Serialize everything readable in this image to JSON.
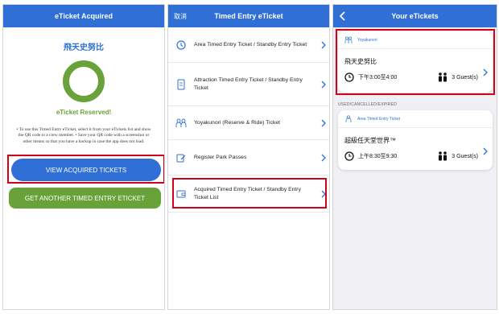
{
  "panel1": {
    "title": "eTicket Acquired",
    "ride_name": "飛天史努比",
    "status": "eTicket Reserved!",
    "note": "• To use this Timed Entry eTicket, select it from your eTickets list and show the QR code to a crew member. • Save your QR code with a screenshot or other means so that you have a backup in case the app does not load.",
    "btn_view": "VIEW ACQUIRED TICKETS",
    "btn_get": "GET ANOTHER TIMED ENTRY ETICKET",
    "colors": {
      "blue": "#2f6fd6",
      "green": "#6aa23a",
      "highlight": "#d0021b"
    }
  },
  "panel2": {
    "cancel": "取消",
    "title": "Timed Entry eTicket",
    "items": [
      {
        "label": "Area Timed Entry Ticket / Standby Entry Ticket",
        "icon": "clock-icon"
      },
      {
        "label": "Attraction Timed Entry Ticket / Standby Entry Ticket",
        "icon": "ticket-icon"
      },
      {
        "label": "Yoyakunori (Reserve & Ride) Ticket",
        "icon": "people-icon"
      },
      {
        "label": "Register Park Passes",
        "icon": "pass-icon"
      },
      {
        "label": "Acquired Timed Entry Ticket / Standby Entry Ticket List",
        "icon": "wallet-icon"
      }
    ]
  },
  "panel3": {
    "title": "Your eTickets",
    "section_label": "USED/CANCELLED/EXPIRED",
    "cards": [
      {
        "type": "Yoyakunori",
        "name": "飛天史努比",
        "time": "下午3:00至4:00",
        "guests": "3 Guest(s)"
      },
      {
        "type": "Area Timed Entry Ticket",
        "name": "超級任天堂世界™",
        "time": "上午8:30至9:30",
        "guests": "3 Guest(s)"
      }
    ]
  }
}
